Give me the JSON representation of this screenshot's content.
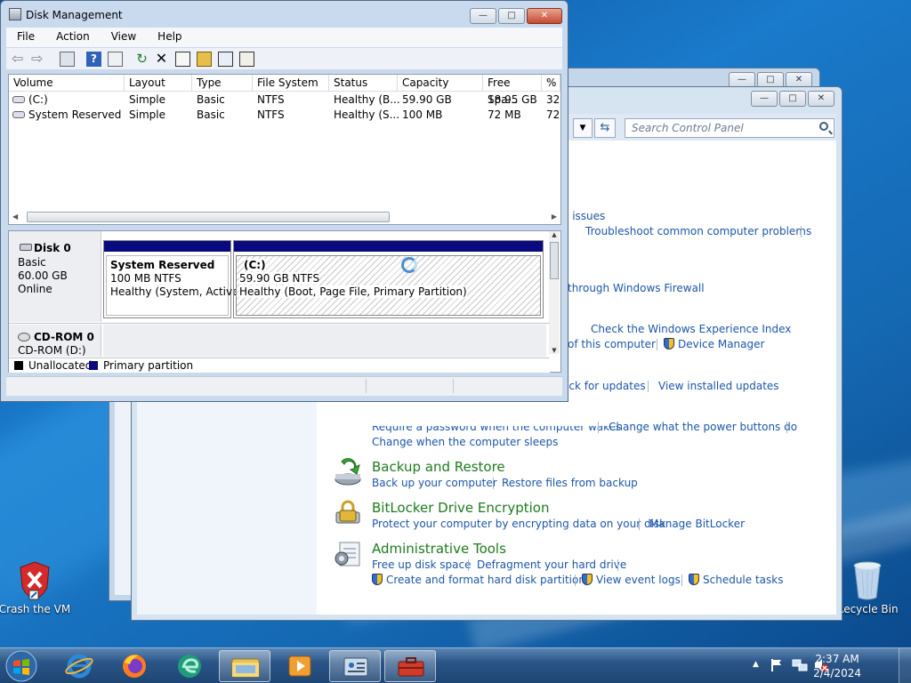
{
  "desktop": {
    "icons": [
      {
        "label": "Crash the VM"
      },
      {
        "label": "Recycle Bin"
      }
    ]
  },
  "control_panel": {
    "search_placeholder": "Search Control Panel",
    "links": {
      "issues": "e issues",
      "troubleshoot": "Troubleshoot common computer problems",
      "firewall": "through Windows Firewall",
      "experience_index": "Check the Windows Experience Index",
      "this_computer": "of this computer",
      "device_manager": "Device Manager",
      "check_updates": "eck for updates",
      "view_updates": "View installed updates",
      "password_wakes": "Require a password when the computer wakes",
      "power_buttons": "Change what the power buttons do",
      "sleep": "Change when the computer sleeps"
    },
    "sections": [
      {
        "title": "Backup and Restore",
        "links": [
          "Back up your computer",
          "Restore files from backup"
        ]
      },
      {
        "title": "BitLocker Drive Encryption",
        "links": [
          "Protect your computer by encrypting data on your disk",
          "Manage BitLocker"
        ]
      },
      {
        "title": "Administrative Tools",
        "links": [
          "Free up disk space",
          "Defragment your hard drive",
          "Create and format hard disk partitions",
          "View event logs",
          "Schedule tasks"
        ]
      }
    ]
  },
  "disk_management": {
    "title": "Disk Management",
    "menu": [
      "File",
      "Action",
      "View",
      "Help"
    ],
    "columns": [
      "Volume",
      "Layout",
      "Type",
      "File System",
      "Status",
      "Capacity",
      "Free Spa...",
      "% F"
    ],
    "rows": [
      [
        "(C:)",
        "Simple",
        "Basic",
        "NTFS",
        "Healthy (B...",
        "59.90 GB",
        "18.95 GB",
        "32"
      ],
      [
        "System Reserved",
        "Simple",
        "Basic",
        "NTFS",
        "Healthy (S...",
        "100 MB",
        "72 MB",
        "72"
      ]
    ],
    "disk0": {
      "name": "Disk 0",
      "type": "Basic",
      "size": "60.00 GB",
      "state": "Online"
    },
    "partitions": [
      {
        "name": "System Reserved",
        "size": "100 MB NTFS",
        "status": "Healthy (System, Active,"
      },
      {
        "name": "(C:)",
        "size": "59.90 GB NTFS",
        "status": "Healthy (Boot, Page File, Primary Partition)"
      }
    ],
    "cdrom": {
      "name": "CD-ROM 0",
      "drive": "CD-ROM (D:)"
    },
    "legend": [
      "Unallocated",
      "Primary partition"
    ]
  },
  "taskbar": {
    "time": "2:37 AM",
    "date": "2/4/2024"
  },
  "colors": {
    "primary_partition": "#0a0a80",
    "link": "#1c56a8",
    "heading_green": "#1e7a1e"
  }
}
